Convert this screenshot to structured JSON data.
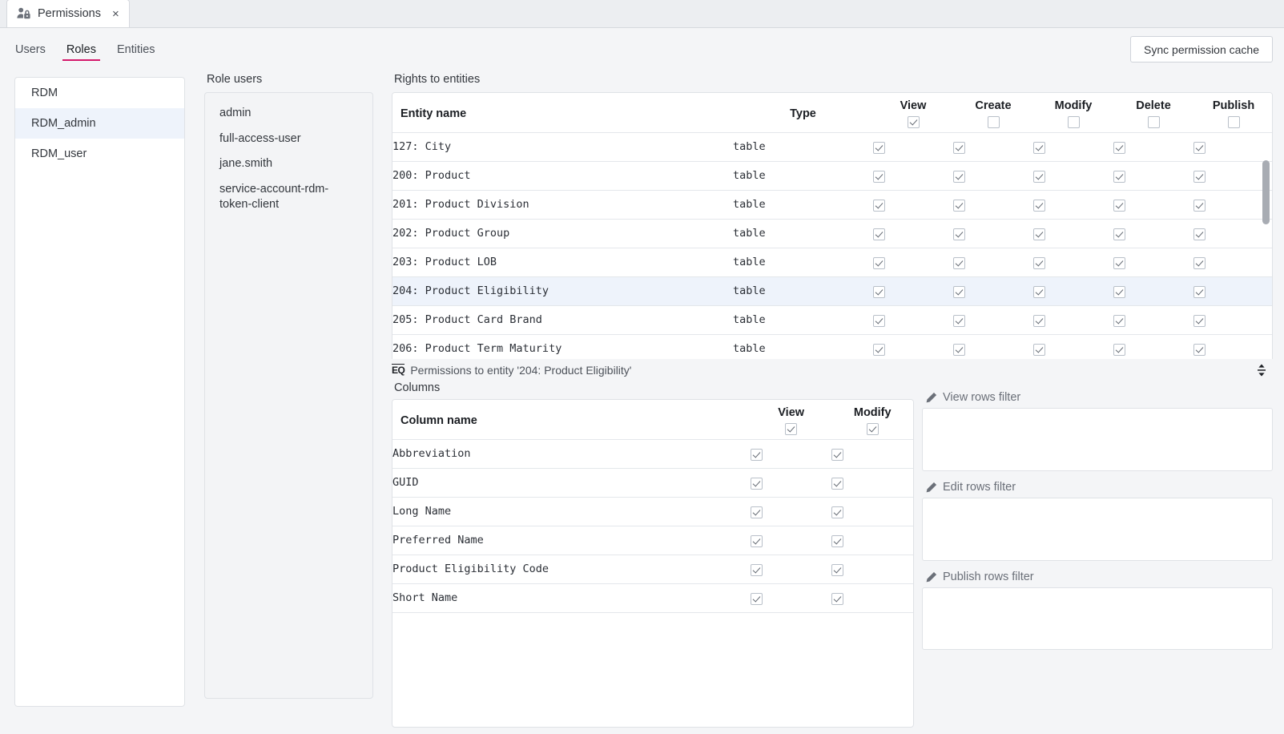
{
  "window": {
    "tab": {
      "title": "Permissions",
      "icon": "user-lock-icon",
      "close": "×"
    }
  },
  "subnav": {
    "items": [
      {
        "label": "Users",
        "active": false
      },
      {
        "label": "Roles",
        "active": true
      },
      {
        "label": "Entities",
        "active": false
      }
    ],
    "sync_button": "Sync permission cache",
    "accent_color": "#d5186b"
  },
  "roles": {
    "items": [
      {
        "label": "RDM",
        "selected": false
      },
      {
        "label": "RDM_admin",
        "selected": true
      },
      {
        "label": "RDM_user",
        "selected": false
      }
    ]
  },
  "role_users": {
    "label": "Role users",
    "items": [
      "admin",
      "full-access-user",
      "jane.smith",
      "service-account-rdm-token-client"
    ]
  },
  "rights_to_entities": {
    "label": "Rights to entities",
    "headers": {
      "name": "Entity name",
      "type": "Type",
      "permissions": [
        "View",
        "Create",
        "Modify",
        "Delete",
        "Publish"
      ]
    },
    "header_checkboxes": [
      true,
      false,
      false,
      false,
      false
    ],
    "rows": [
      {
        "name": "127: City",
        "type": "table",
        "perms": [
          true,
          true,
          true,
          true,
          true
        ],
        "selected": false
      },
      {
        "name": "200: Product",
        "type": "table",
        "perms": [
          true,
          true,
          true,
          true,
          true
        ],
        "selected": false
      },
      {
        "name": "201: Product Division",
        "type": "table",
        "perms": [
          true,
          true,
          true,
          true,
          true
        ],
        "selected": false
      },
      {
        "name": "202: Product Group",
        "type": "table",
        "perms": [
          true,
          true,
          true,
          true,
          true
        ],
        "selected": false
      },
      {
        "name": "203: Product LOB",
        "type": "table",
        "perms": [
          true,
          true,
          true,
          true,
          true
        ],
        "selected": false
      },
      {
        "name": "204: Product Eligibility",
        "type": "table",
        "perms": [
          true,
          true,
          true,
          true,
          true
        ],
        "selected": true
      },
      {
        "name": "205: Product Card Brand",
        "type": "table",
        "perms": [
          true,
          true,
          true,
          true,
          true
        ],
        "selected": false
      },
      {
        "name": "206: Product Term Maturity",
        "type": "table",
        "perms": [
          true,
          true,
          true,
          true,
          true
        ],
        "selected": false
      }
    ]
  },
  "splitter": {
    "icon": "eq-table-icon",
    "icon_text": "EQ",
    "title": "Permissions to entity '204: Product Eligibility'",
    "resize_icon": "vertical-resize-icon"
  },
  "columns_section": {
    "label": "Columns",
    "headers": {
      "name": "Column name",
      "permissions": [
        "View",
        "Modify"
      ]
    },
    "header_checkboxes": [
      true,
      true
    ],
    "rows": [
      {
        "name": "Abbreviation",
        "perms": [
          true,
          true
        ]
      },
      {
        "name": "GUID",
        "perms": [
          true,
          true
        ]
      },
      {
        "name": "Long Name",
        "perms": [
          true,
          true
        ]
      },
      {
        "name": "Preferred Name",
        "perms": [
          true,
          true
        ]
      },
      {
        "name": "Product Eligibility Code",
        "perms": [
          true,
          true
        ]
      },
      {
        "name": "Short Name",
        "perms": [
          true,
          true
        ]
      }
    ]
  },
  "row_filters": [
    {
      "label": "View rows filter",
      "value": "",
      "icon": "pencil-icon"
    },
    {
      "label": "Edit rows filter",
      "value": "",
      "icon": "pencil-icon"
    },
    {
      "label": "Publish rows filter",
      "value": "",
      "icon": "pencil-icon"
    }
  ]
}
